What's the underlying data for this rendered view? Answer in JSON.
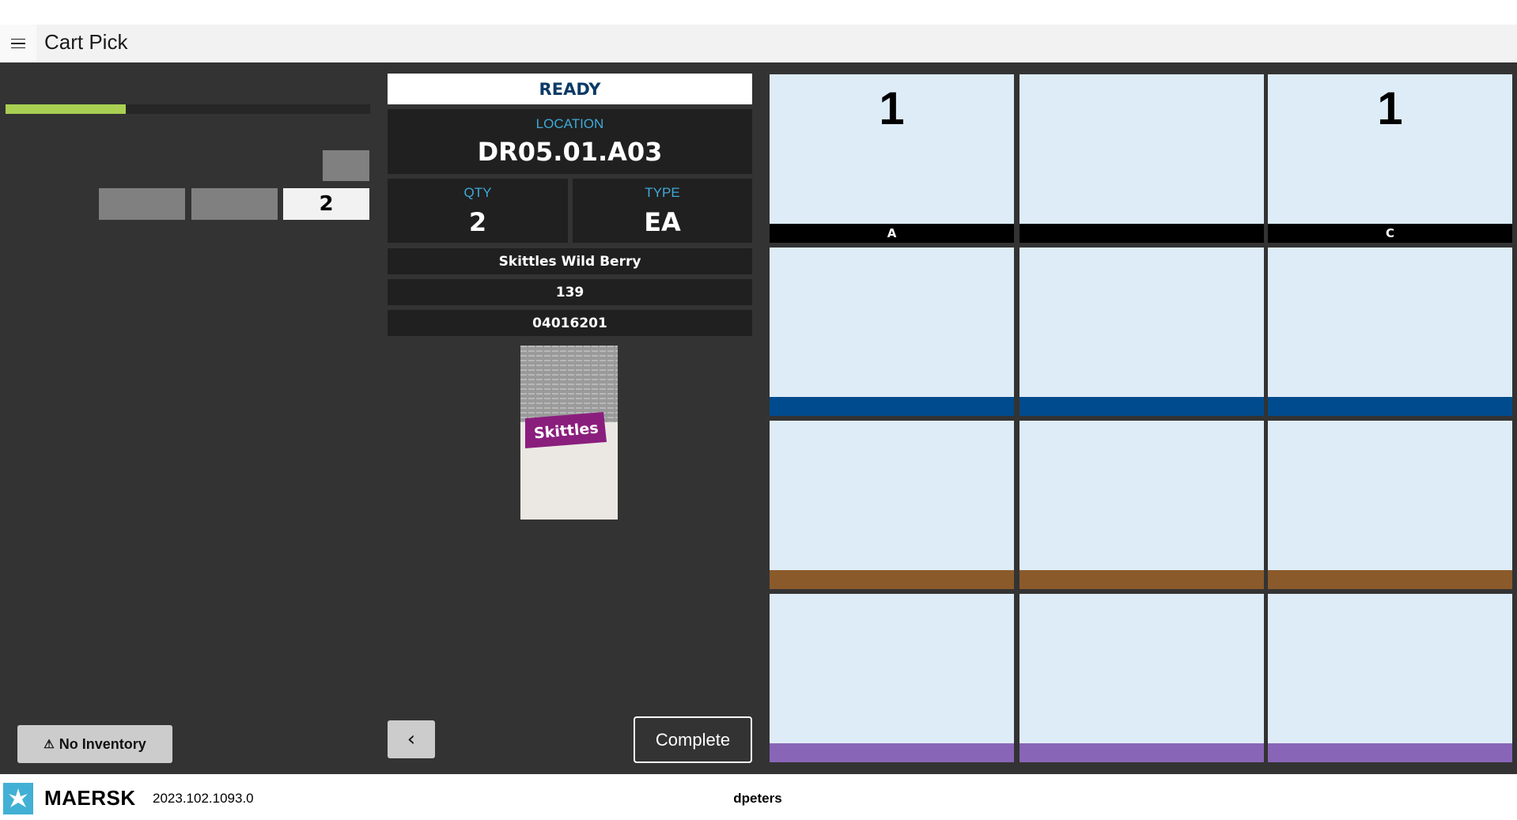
{
  "header": {
    "title": "Cart Pick",
    "menu_icon": "hamburger-icon"
  },
  "left": {
    "progress_percent": 33,
    "progress_color": "#a9d052",
    "count_value": "2",
    "no_inventory_label": "No Inventory",
    "warning_icon": "⚠"
  },
  "pick": {
    "status": "READY",
    "location_label": "LOCATION",
    "location": "DR05.01.A03",
    "qty_label": "QTY",
    "qty": "2",
    "type_label": "TYPE",
    "type": "EA",
    "description": "Skittles Wild Berry",
    "item_number": "139",
    "barcode": "04016201",
    "product_image": {
      "brand_text": "Skittles"
    },
    "back_icon": "‹",
    "complete_label": "Complete"
  },
  "cart": {
    "rows": [
      {
        "color": "#000000",
        "tiles": [
          {
            "count": "1",
            "label": "A"
          },
          {
            "count": "",
            "label": ""
          },
          {
            "count": "1",
            "label": "C"
          }
        ]
      },
      {
        "color": "#004b8d",
        "tiles": [
          {
            "count": "",
            "label": ""
          },
          {
            "count": "",
            "label": ""
          },
          {
            "count": "",
            "label": ""
          }
        ]
      },
      {
        "color": "#8b5a2b",
        "tiles": [
          {
            "count": "",
            "label": ""
          },
          {
            "count": "",
            "label": ""
          },
          {
            "count": "",
            "label": ""
          }
        ]
      },
      {
        "color": "#8965b8",
        "tiles": [
          {
            "count": "",
            "label": ""
          },
          {
            "count": "",
            "label": ""
          },
          {
            "count": "",
            "label": ""
          }
        ]
      }
    ]
  },
  "footer": {
    "brand": "MAERSK",
    "version": "2023.102.1093.0",
    "user": "dpeters",
    "brand_color": "#42b0d5"
  }
}
